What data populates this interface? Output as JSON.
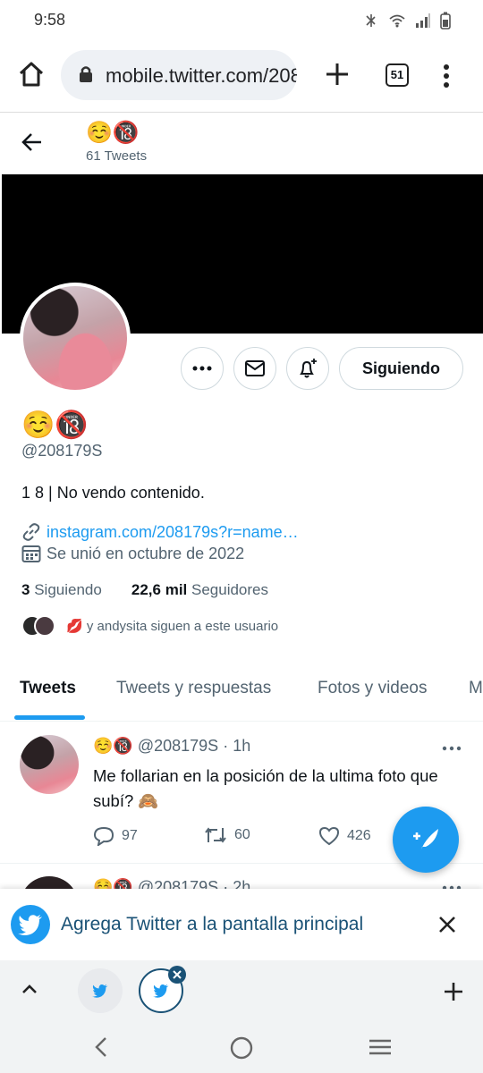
{
  "status": {
    "time": "9:58"
  },
  "browser": {
    "url": "mobile.twitter.com/208179S",
    "tab_count": "51"
  },
  "profile": {
    "header_name": "☺️🔞",
    "tweet_count": "61 Tweets",
    "display_name": "☺️🔞",
    "handle": "@208179S",
    "bio": "1 8 | No vendo contenido.",
    "link": "instagram.com/208179s?r=name…",
    "joined": "Se unió en octubre de 2022",
    "following_count": "3",
    "following_label": "Siguiendo",
    "followers_count": "22,6 mil",
    "followers_label": "Seguidores",
    "followed_by": "💋 y andysita siguen a este usuario",
    "follow_button": "Siguiendo"
  },
  "tabs": [
    "Tweets",
    "Tweets y respuestas",
    "Fotos y videos",
    "M"
  ],
  "tweets": [
    {
      "name": "☺️🔞",
      "handle": "@208179S",
      "time": "· 1h",
      "text": "Me follarian en la posición de la ultima foto que subí? 🙈",
      "replies": "97",
      "retweets": "60",
      "likes": "426"
    },
    {
      "name": "☺️🔞",
      "handle": "@208179S",
      "time": "· 2h"
    }
  ],
  "banner_prompt": {
    "text": "Agrega Twitter a la pantalla principal"
  },
  "colors": {
    "twitter_blue": "#1d9bf0",
    "text": "#0f1419",
    "muted": "#536471"
  }
}
